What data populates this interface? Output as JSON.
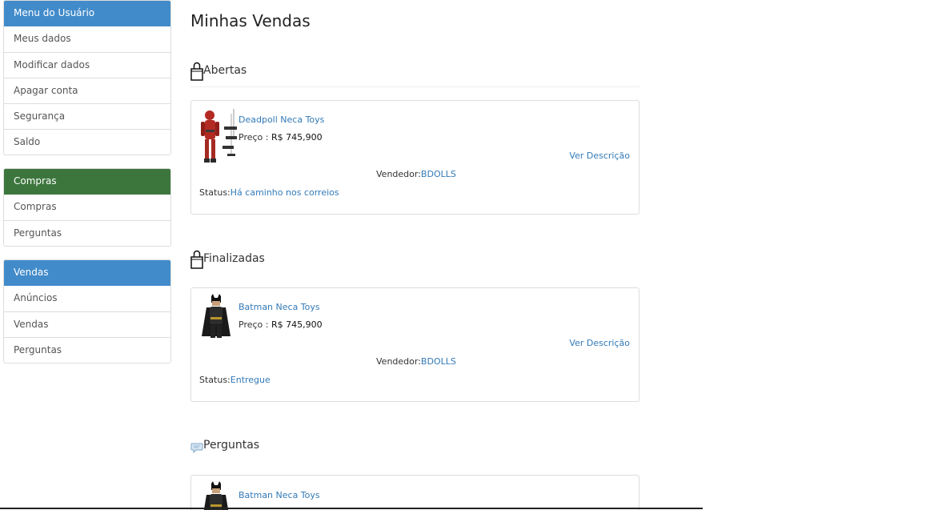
{
  "sidebar": {
    "user_menu": {
      "title": "Menu do Usuário",
      "items": [
        "Meus dados",
        "Modificar dados",
        "Apagar conta",
        "Segurança",
        "Saldo"
      ]
    },
    "purchases": {
      "title": "Compras",
      "items": [
        "Compras",
        "Perguntas"
      ]
    },
    "sales": {
      "title": "Vendas",
      "items": [
        "Anúncios",
        "Vendas",
        "Perguntas"
      ]
    }
  },
  "main": {
    "title": "Minhas Vendas",
    "sections": {
      "open": {
        "title": "Abertas",
        "icon": "shopping-bag-icon"
      },
      "finished": {
        "title": "Finalizadas",
        "icon": "shopping-bag-icon"
      },
      "questions": {
        "title": "Perguntas",
        "icon": "chat-bubble-icon"
      }
    },
    "cards": [
      {
        "product": "Deadpoll Neca Toys",
        "price_label": "Preço :",
        "price_value": "R$ 745,900",
        "description_link": "Ver Descrição",
        "seller_label": "Vendedor:",
        "seller": "BDOLLS",
        "status_label": "Status:",
        "status": "Há caminho nos correios"
      },
      {
        "product": "Batman Neca Toys",
        "price_label": "Preço :",
        "price_value": "R$ 745,900",
        "description_link": "Ver Descrição",
        "seller_label": "Vendedor:",
        "seller": "BDOLLS",
        "status_label": "Status:",
        "status": "Entregue"
      },
      {
        "product": "Batman Neca Toys"
      }
    ]
  },
  "colors": {
    "primary": "#428bca",
    "success": "#3c763d",
    "link": "#337ab7",
    "border": "#dddddd"
  }
}
